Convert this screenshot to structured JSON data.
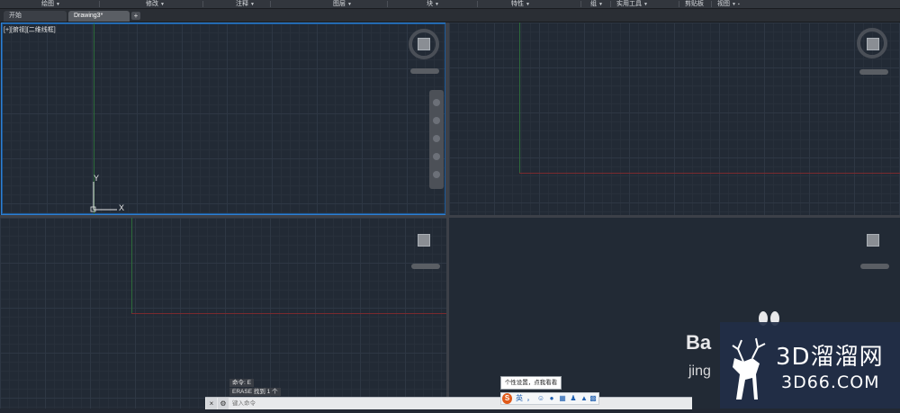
{
  "ribbon": {
    "items": [
      {
        "label": "绘图"
      },
      {
        "label": "修改"
      },
      {
        "label": "注释"
      },
      {
        "label": "图层"
      },
      {
        "label": "块"
      },
      {
        "label": "特性"
      },
      {
        "label": "组"
      },
      {
        "label": "实用工具"
      },
      {
        "label": "剪贴板"
      },
      {
        "label": "视图"
      }
    ]
  },
  "tabs": [
    {
      "label": "开始"
    },
    {
      "label": "Drawing3*"
    }
  ],
  "tab_add": "+",
  "viewport1": {
    "label": "[+][俯视][二维线框]"
  },
  "ucs": {
    "y_label": "Y",
    "x_label": "X"
  },
  "command": {
    "history": [
      "命令: E",
      "ERASE 找到 1 个"
    ],
    "placeholder": "键入命令",
    "close_icon": "×",
    "settings_icon": "wrench-icon"
  },
  "ime_tooltip": "个性设置，点我看看",
  "ime": {
    "logo": "S",
    "lang": "英",
    "punct": "，"
  },
  "watermark": {
    "brand": "Ba",
    "brand2": "jing",
    "big": "3D溜溜网",
    "small": "3D66.COM"
  },
  "colors": {
    "grid_bg": "#222a35",
    "active_border": "#2f7fd0",
    "x_axis": "#7a2a2e",
    "y_axis": "#2d6b3a"
  }
}
